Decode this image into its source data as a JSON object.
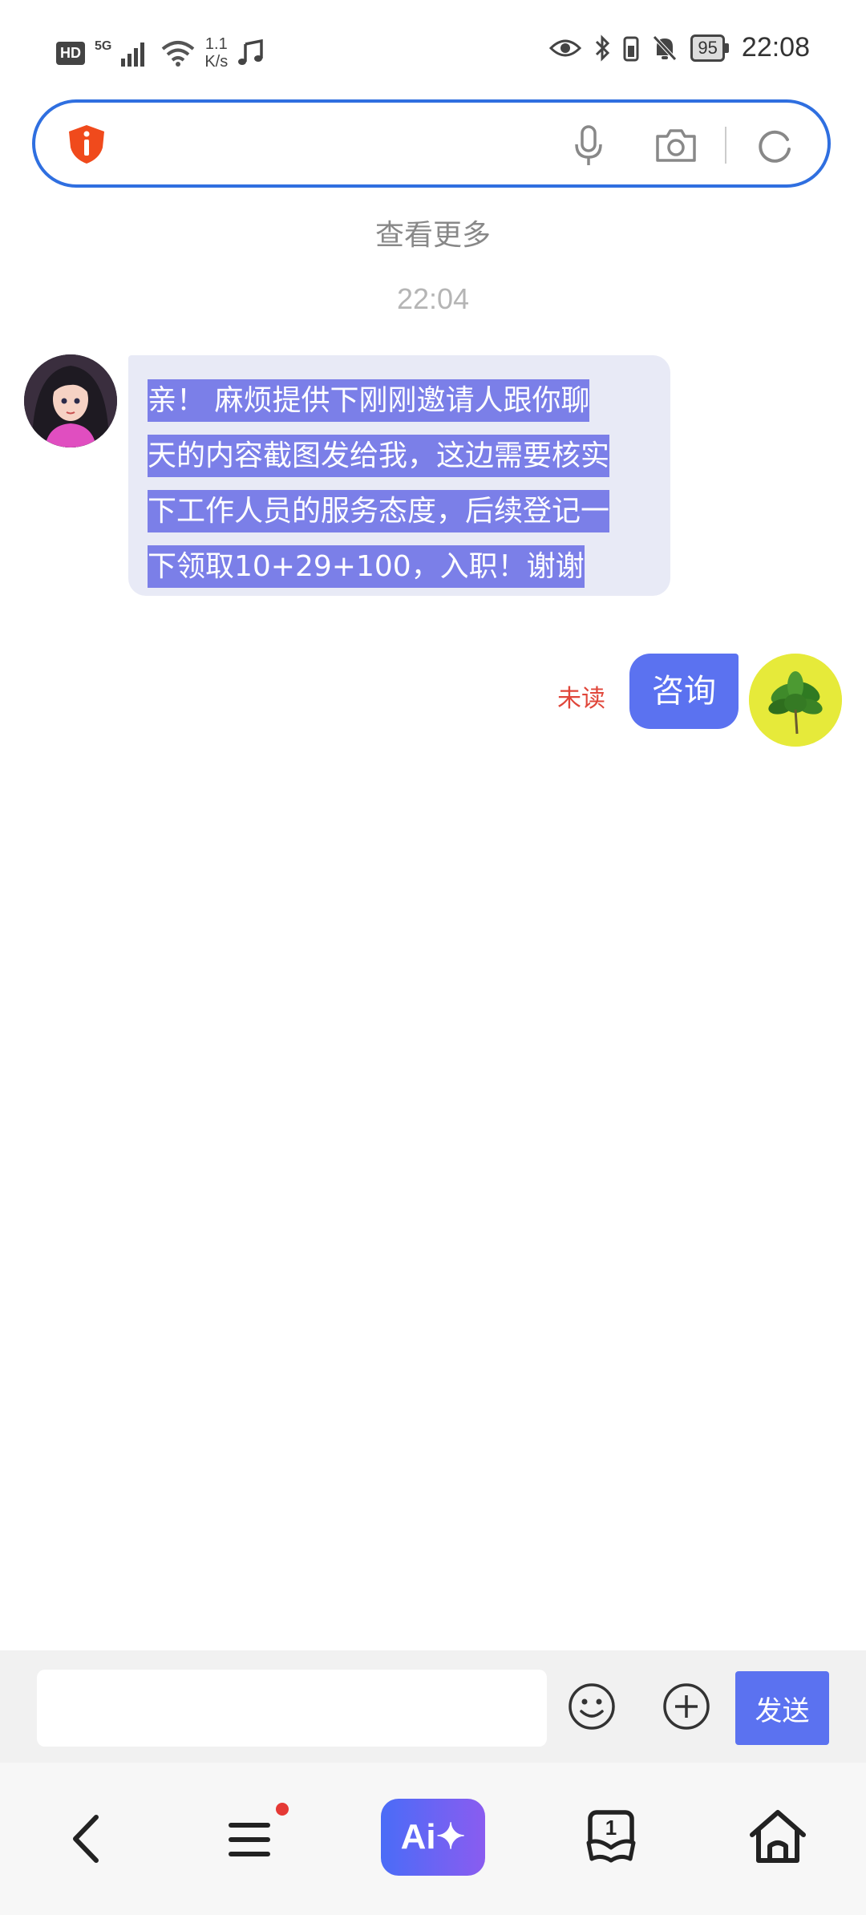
{
  "status_bar": {
    "hd": "HD",
    "network": "5G",
    "speed_value": "1.1",
    "speed_unit": "K/s",
    "battery": "95",
    "time": "22:08"
  },
  "search": {
    "value": "",
    "placeholder": ""
  },
  "chat": {
    "see_more": "查看更多",
    "timestamp": "22:04",
    "incoming_message": {
      "lines": [
        "亲！ 麻烦提供下刚刚邀请人跟你聊",
        "天的内容截图发给我，这边需要核实",
        "下工作人员的服务态度，后续登记一",
        "下领取10+29+100，入职！谢谢"
      ]
    },
    "outgoing_message": {
      "text": "咨询",
      "status": "未读"
    }
  },
  "composer": {
    "input_value": "",
    "send_label": "发送"
  },
  "bottom_nav": {
    "ai_label": "Ai✦",
    "tabs_count": "1"
  },
  "colors": {
    "accent": "#5b72f0",
    "search_border": "#2f6fe0",
    "selection": "#7b7fe8",
    "unread": "#e0463a",
    "incoming_bubble": "#e8eaf6"
  },
  "icons": [
    "shield-icon",
    "mic-icon",
    "camera-icon",
    "refresh-icon",
    "emoji-icon",
    "plus-icon",
    "back-icon",
    "menu-icon",
    "tabs-icon",
    "home-icon"
  ]
}
